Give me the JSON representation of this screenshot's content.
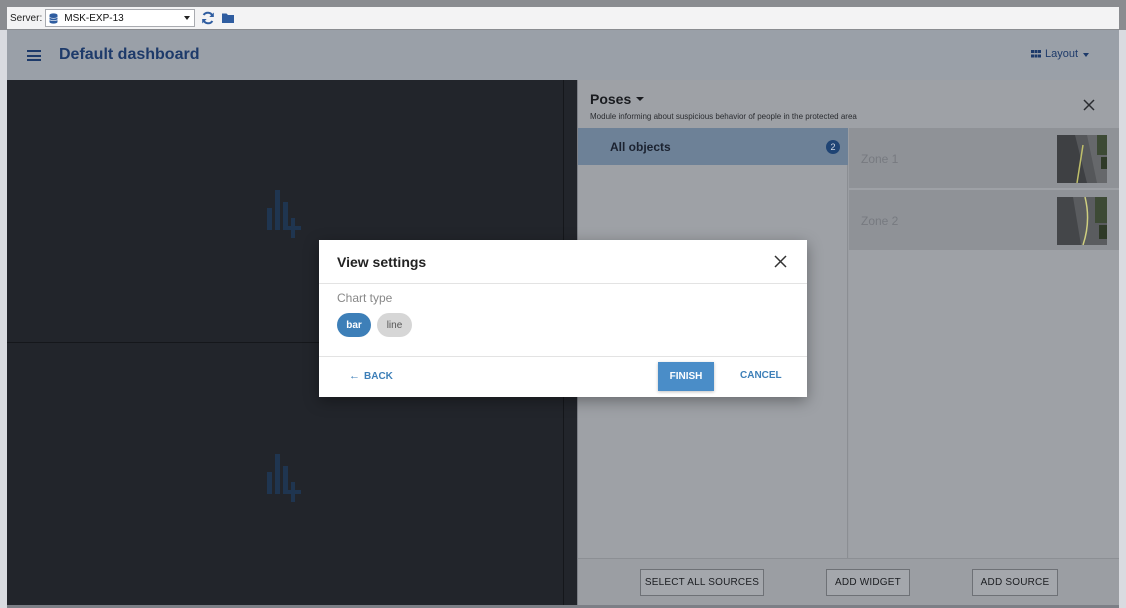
{
  "toolbar": {
    "server_label": "Server:",
    "server_value": "MSK-EXP-13"
  },
  "header": {
    "title": "Default dashboard",
    "layout_label": "Layout"
  },
  "panel": {
    "title": "Poses",
    "subtitle": "Module informing about suspicious behavior of people in the protected area",
    "all_objects_label": "All objects",
    "all_objects_count": "2",
    "zones": [
      {
        "label": "Zone 1"
      },
      {
        "label": "Zone 2"
      }
    ],
    "footer": {
      "select_all": "SELECT ALL SOURCES",
      "add_widget": "ADD WIDGET",
      "add_source": "ADD SOURCE"
    }
  },
  "modal": {
    "title": "View settings",
    "chart_type_label": "Chart type",
    "options": [
      "bar",
      "line"
    ],
    "selected": "bar",
    "back": "BACK",
    "finish": "FINISH",
    "cancel": "CANCEL"
  },
  "colors": {
    "accent": "#3d7fb8",
    "dark_bg": "#22252b",
    "header_text": "#1d3a6a"
  }
}
